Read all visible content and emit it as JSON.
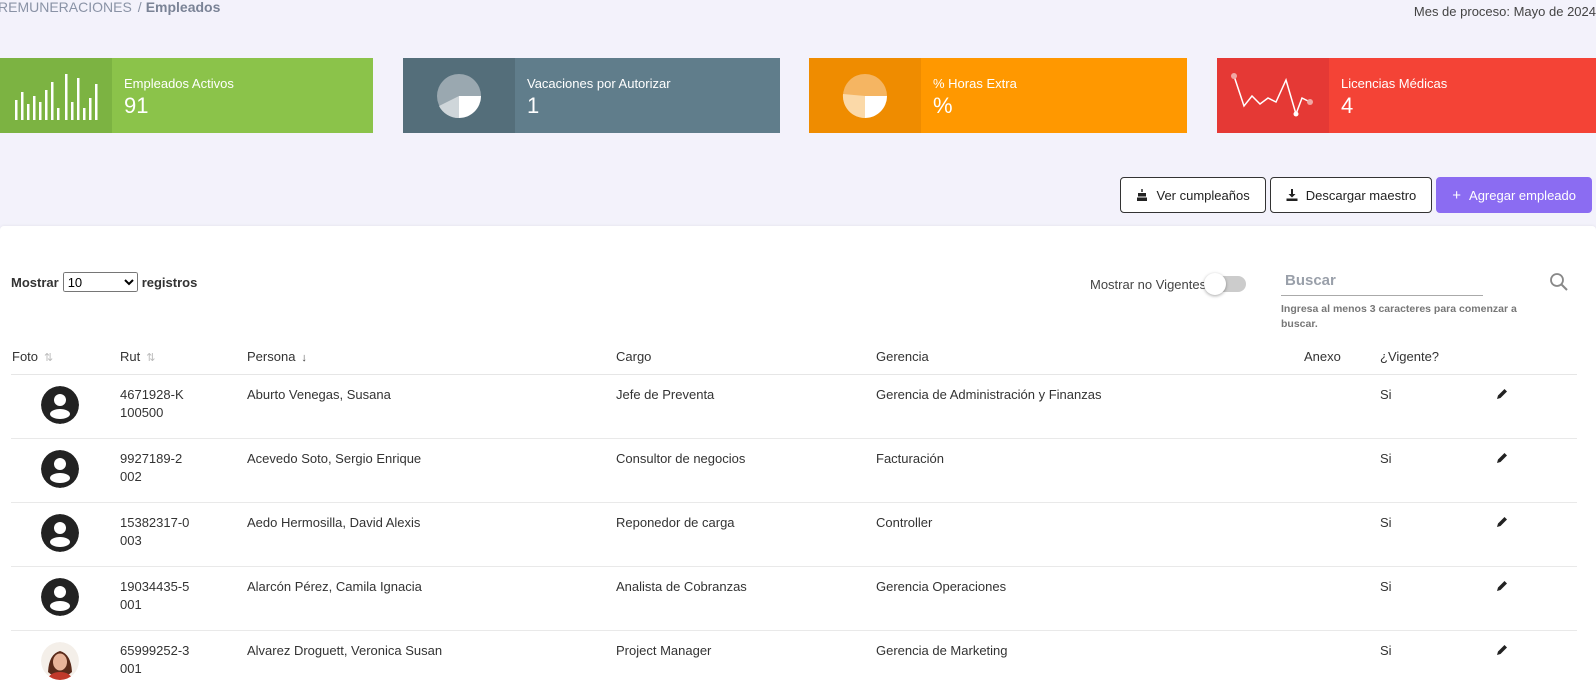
{
  "breadcrumb": {
    "parent": "REMUNERACIONES",
    "separator": "/",
    "current": "Empleados"
  },
  "process_month": "Mes de proceso: Mayo de 2024",
  "stats": [
    {
      "label": "Empleados Activos",
      "value": "91",
      "icon": "bar-chart-icon",
      "color": "#8bc34a"
    },
    {
      "label": "Vacaciones por Autorizar",
      "value": "1",
      "icon": "pie-chart-icon",
      "color": "#607d8b"
    },
    {
      "label": "% Horas Extra",
      "value": "%",
      "icon": "pie-chart-icon",
      "color": "#ff9800"
    },
    {
      "label": "Licencias Médicas",
      "value": "4",
      "icon": "line-chart-icon",
      "color": "#f44336"
    }
  ],
  "actions": {
    "birthdays": "Ver cumpleaños",
    "download": "Descargar maestro",
    "add": "Agregar empleado"
  },
  "table_controls": {
    "show_prefix": "Mostrar",
    "show_suffix": "registros",
    "page_size": "10",
    "page_size_options": [
      "10"
    ],
    "toggle_label": "Mostrar no Vigentes",
    "search_placeholder": "Buscar",
    "search_help": "Ingresa al menos 3 caracteres para comenzar a buscar."
  },
  "columns": [
    "Foto",
    "Rut",
    "Persona",
    "Cargo",
    "Gerencia",
    "Anexo",
    "¿Vigente?"
  ],
  "rows": [
    {
      "rut": "4671928-K",
      "code": "100500",
      "person": "Aburto Venegas, Susana",
      "cargo": "Jefe de Preventa",
      "gerencia": "Gerencia de Administración y Finanzas",
      "anexo": "",
      "vigente": "Si",
      "photo": "default-avatar-icon"
    },
    {
      "rut": "9927189-2",
      "code": "002",
      "person": "Acevedo Soto, Sergio Enrique",
      "cargo": "Consultor de negocios",
      "gerencia": "Facturación",
      "anexo": "",
      "vigente": "Si",
      "photo": "default-avatar-icon"
    },
    {
      "rut": "15382317-0",
      "code": "003",
      "person": "Aedo Hermosilla, David Alexis",
      "cargo": "Reponedor de carga",
      "gerencia": "Controller",
      "anexo": "",
      "vigente": "Si",
      "photo": "default-avatar-icon"
    },
    {
      "rut": "19034435-5",
      "code": "001",
      "person": "Alarcón Pérez, Camila Ignacia",
      "cargo": "Analista de Cobranzas",
      "gerencia": "Gerencia Operaciones",
      "anexo": "",
      "vigente": "Si",
      "photo": "default-avatar-icon"
    },
    {
      "rut": "65999252-3",
      "code": "001",
      "person": "Alvarez Droguett, Veronica Susan",
      "cargo": "Project Manager",
      "gerencia": "Gerencia de Marketing",
      "anexo": "",
      "vigente": "Si",
      "photo": "user-photo"
    }
  ]
}
